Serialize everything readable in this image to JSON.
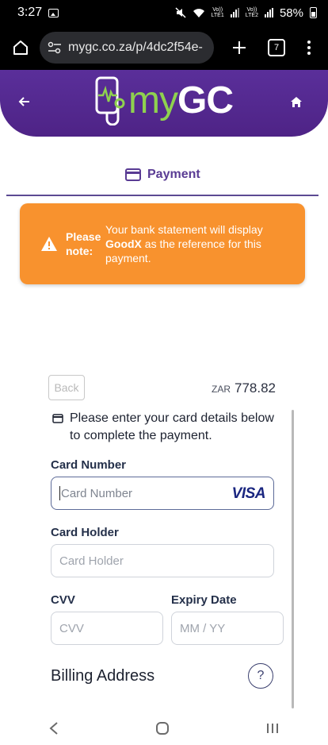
{
  "status_bar": {
    "time": "3:27",
    "battery": "58%",
    "sim1": "LTE1",
    "sim2": "LTE2",
    "volte": "Vo))"
  },
  "browser": {
    "url": "mygc.co.za/p/4dc2f54e-",
    "tab_count": "7"
  },
  "header": {
    "logo_my": "my",
    "logo_gc": "GC"
  },
  "payment_tab": {
    "label": "Payment"
  },
  "notice": {
    "label": "Please note:",
    "text_before": "Your bank statement will display ",
    "text_bold": "GoodX",
    "text_after": " as the reference for this payment.",
    "color": "#f8922e"
  },
  "form": {
    "back_label": "Back",
    "currency": "ZAR",
    "amount": "778.82",
    "heading": "Please enter your card details below to complete the payment.",
    "card_number": {
      "label": "Card Number",
      "placeholder": "Card Number",
      "brand": "VISA"
    },
    "card_holder": {
      "label": "Card Holder",
      "placeholder": "Card Holder"
    },
    "cvv": {
      "label": "CVV",
      "placeholder": "CVV"
    },
    "expiry": {
      "label": "Expiry Date",
      "placeholder": "MM / YY"
    },
    "billing_title": "Billing Address",
    "help": "?"
  },
  "theme": {
    "primary": "#5a2f9a",
    "accent_green": "#8fd14f",
    "visa_blue": "#1a2680"
  }
}
